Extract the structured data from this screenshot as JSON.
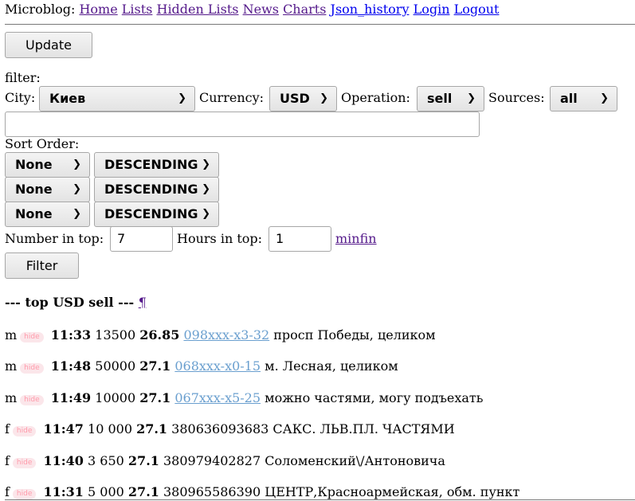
{
  "nav": {
    "brand": "Microblog:",
    "links": [
      "Home",
      "Lists",
      "Hidden Lists",
      "News",
      "Charts",
      "Json_history",
      "Login",
      "Logout"
    ]
  },
  "update_button": "Update",
  "filter_label": "filter:",
  "city": {
    "label": "City:",
    "value": "Киев"
  },
  "currency": {
    "label": "Currency:",
    "value": "USD"
  },
  "operation": {
    "label": "Operation:",
    "value": "sell"
  },
  "sources": {
    "label": "Sources:",
    "value": "all"
  },
  "text_filter_value": "",
  "sort_order_label": "Sort Order:",
  "sort_rows": [
    {
      "field": "None",
      "direction": "DESCENDING"
    },
    {
      "field": "None",
      "direction": "DESCENDING"
    },
    {
      "field": "None",
      "direction": "DESCENDING"
    }
  ],
  "number_in_top": {
    "label": "Number in top:",
    "value": "7"
  },
  "hours_in_top": {
    "label": "Hours in top:",
    "value": "1"
  },
  "minfin_link": "minfin",
  "filter_button": "Filter",
  "result_header": "--- top USD sell ---",
  "pilcrow": "¶",
  "hide_label": "hide",
  "entries": [
    {
      "flag": "m",
      "time": "11:33",
      "amount": "13500",
      "rate": "26.85",
      "phone": "098xxx-x3-32",
      "phone_is_link": true,
      "note": "просп Победы, целиком"
    },
    {
      "flag": "m",
      "time": "11:48",
      "amount": "50000",
      "rate": "27.1",
      "phone": "068xxx-x0-15",
      "phone_is_link": true,
      "note": "м. Лесная, целиком"
    },
    {
      "flag": "m",
      "time": "11:49",
      "amount": "10000",
      "rate": "27.1",
      "phone": "067xxx-x5-25",
      "phone_is_link": true,
      "note": "можно частями, могу подъехать"
    },
    {
      "flag": "f",
      "time": "11:47",
      "amount": "10 000",
      "rate": "27.1",
      "phone": "380636093683",
      "phone_is_link": false,
      "note": "САКС. ЛЬВ.ПЛ. ЧАСТЯМИ"
    },
    {
      "flag": "f",
      "time": "11:40",
      "amount": "3 650",
      "rate": "27.1",
      "phone": "380979402827",
      "phone_is_link": false,
      "note": "Соломенский\\/Антоновича"
    },
    {
      "flag": "f",
      "time": "11:31",
      "amount": "5 000",
      "rate": "27.1",
      "phone": "380965586390",
      "phone_is_link": false,
      "note": "ЦЕНТР,Красноармейская, обм. пункт"
    }
  ]
}
